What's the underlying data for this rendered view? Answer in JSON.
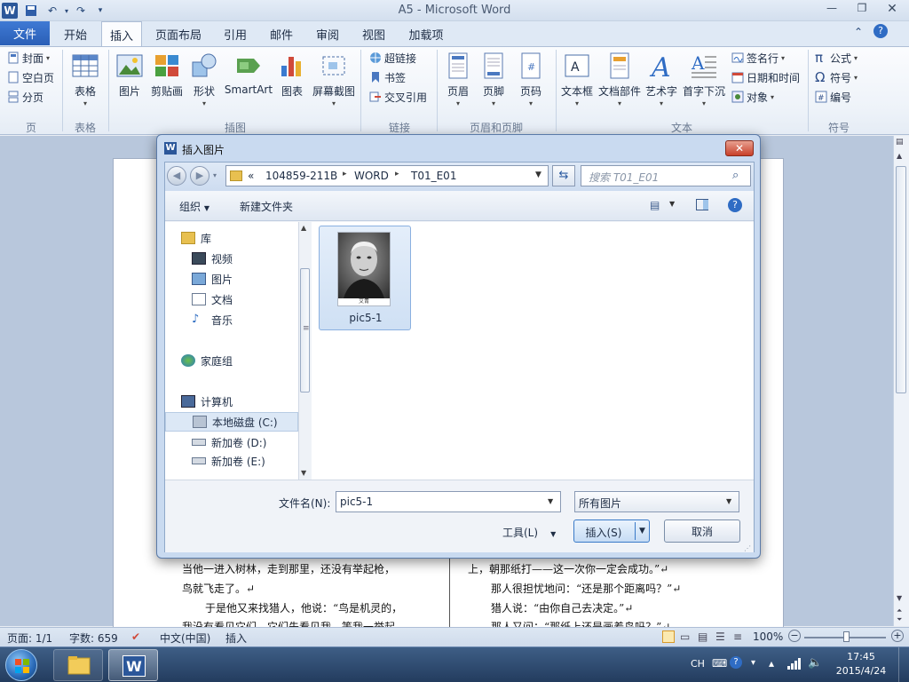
{
  "window": {
    "title": "A5 - Microsoft Word"
  },
  "tabs": [
    "文件",
    "开始",
    "插入",
    "页面布局",
    "引用",
    "邮件",
    "审阅",
    "视图",
    "加载项"
  ],
  "ribbon": {
    "page_group": {
      "label": "页",
      "items": [
        "封面",
        "空白页",
        "分页"
      ]
    },
    "table_group": {
      "label": "表格",
      "items": [
        "表格"
      ]
    },
    "illustrations_group": {
      "label": "插图",
      "items": [
        "图片",
        "剪贴画",
        "形状",
        "SmartArt",
        "图表",
        "屏幕截图"
      ]
    },
    "links_group": {
      "label": "链接",
      "items": [
        "超链接",
        "书签",
        "交叉引用"
      ]
    },
    "header_footer_group": {
      "label": "页眉和页脚",
      "items": [
        "页眉",
        "页脚",
        "页码"
      ]
    },
    "text_group": {
      "label": "文本",
      "items": [
        "文本框",
        "文档部件",
        "艺术字",
        "首字下沉"
      ],
      "small_items": [
        "签名行",
        "日期和时间",
        "对象"
      ]
    },
    "symbols_group": {
      "label": "符号",
      "items": [
        "公式",
        "符号",
        "编号"
      ]
    }
  },
  "dialog": {
    "title": "插入图片",
    "address": {
      "prefix": "«",
      "parts": [
        "104859-211B",
        "WORD",
        "T01_E01"
      ]
    },
    "search_placeholder": "搜索 T01_E01",
    "organize": "组织",
    "new_folder": "新建文件夹",
    "nav": {
      "library": "库",
      "library_items": [
        "视频",
        "图片",
        "文档",
        "音乐"
      ],
      "homegroup": "家庭组",
      "computer": "计算机",
      "drives": [
        "本地磁盘 (C:)",
        "新加卷 (D:)",
        "新加卷 (E:)"
      ]
    },
    "file": {
      "name": "pic5-1",
      "caption": "艾青"
    },
    "filename_label": "文件名(N):",
    "filename_value": "pic5-1",
    "filter": "所有图片",
    "tools": "工具(L)",
    "insert": "插入(S)",
    "cancel": "取消"
  },
  "document": {
    "left_lines": [
      "当他一进入树林，走到那里，还没有举起枪，",
      "鸟就飞走了。↵",
      "于是他又来找猎人，他说：“鸟是机灵的，",
      "我没有看见它们，它们先看见我，等我一举起"
    ],
    "right_lines": [
      "上，朝那纸打——这一次你一定会成功。”↵",
      "那人很担忧地问：“还是那个距离吗？”↵",
      "猎人说：“由你自己去决定。”↵",
      "那人又问：“那纸上还是画着鸟吗？”↵"
    ]
  },
  "statusbar": {
    "page": "页面: 1/1",
    "words": "字数: 659",
    "language": "中文(中国)",
    "mode": "插入",
    "zoom": "100%"
  },
  "taskbar": {
    "lang": "CH",
    "time": "17:45",
    "date": "2015/4/24"
  }
}
